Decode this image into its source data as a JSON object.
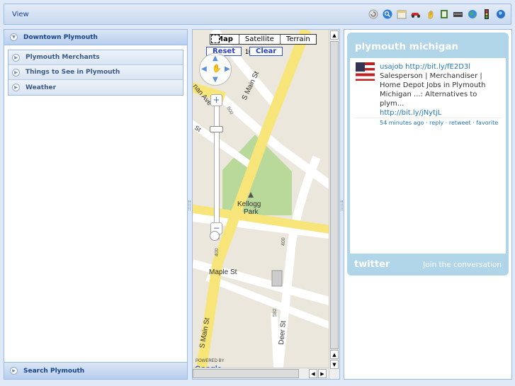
{
  "toolbar": {
    "view_label": "View",
    "icons": [
      "refresh-icon",
      "search-icon",
      "window-icon",
      "car-icon",
      "hand-icon",
      "document-icon",
      "keyboard-icon",
      "globe-icon",
      "traffic-light-icon",
      "globe-blue-icon"
    ]
  },
  "left_panel": {
    "header": "Downtown Plymouth",
    "items": [
      "Plymouth Merchants",
      "Things to See in Plymouth",
      "Weather"
    ],
    "footer": "Search Plymouth"
  },
  "map": {
    "type_buttons": [
      "Map",
      "Satellite",
      "Terrain"
    ],
    "reset_label": "Reset",
    "clear_label": "Clear",
    "labels": {
      "s_main_st_top": "S Main St",
      "s_main_st_bottom": "S Main St",
      "park": "Kellogg Park",
      "maple": "Maple St",
      "deer": "Deer St",
      "ann_arbor": "nan Ave",
      "num_800": "800",
      "num_400a": "400",
      "num_400b": "400",
      "num_582": "582",
      "st_left": "St",
      "scale": "100 ft",
      "powered": "POWERED BY",
      "google": "Google"
    }
  },
  "twitter": {
    "title": "plymouth michigan",
    "tweet": {
      "user": "usajob",
      "link1": "http://bit.ly/fE2D3l",
      "text": "Salesperson | Merchandiser | Home Depot Jobs in Plymouth Michigan ...: Alternatives to plym...",
      "link2": "http://bit.ly/jNytjL",
      "time": "54 minutes ago",
      "reply": "reply",
      "retweet": "retweet",
      "favorite": "favorite"
    },
    "logo": "twitter",
    "join": "Join the conversation"
  },
  "colors": {
    "accent": "#99bbe8",
    "header_text": "#15428b",
    "twitter_bg": "#b0d5e8",
    "road": "#f8e57a",
    "park": "#b9d99a"
  }
}
